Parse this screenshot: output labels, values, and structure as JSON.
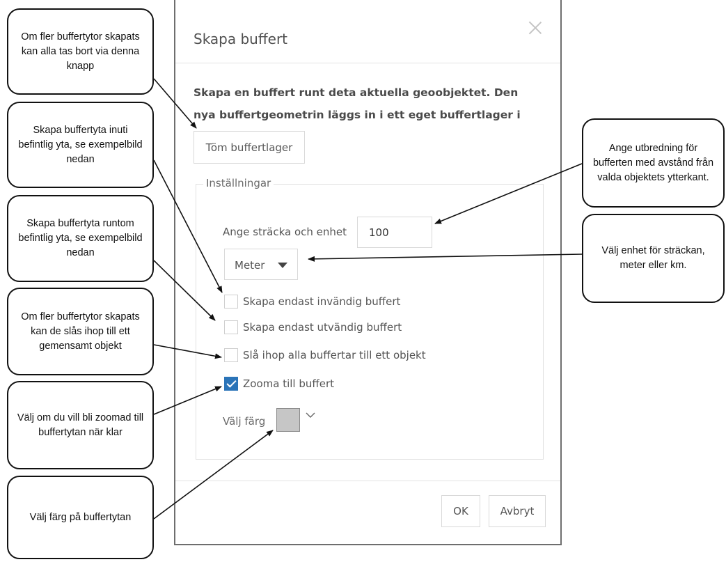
{
  "dialog": {
    "title": "Skapa buffert",
    "description": "Skapa en buffert runt deta aktuella geoobjektet. Den nya buffertgeometrin läggs in i ett eget buffertlager i kartan.",
    "clear_button": "Töm buffertlager",
    "settings_legend": "Inställningar",
    "distance_label": "Ange sträcka och enhet",
    "distance_value": "100",
    "unit_selected": "Meter",
    "checkboxes": [
      {
        "label": "Skapa endast invändig buffert",
        "checked": false
      },
      {
        "label": "Skapa endast utvändig buffert",
        "checked": false
      },
      {
        "label": "Slå ihop alla buffertar till ett objekt",
        "checked": false
      },
      {
        "label": "Zooma till buffert",
        "checked": true
      }
    ],
    "color_label": "Välj färg",
    "color_value": "#c6c6c6",
    "ok_button": "OK",
    "cancel_button": "Avbryt",
    "accent_color": "#2b74b8"
  },
  "callouts": {
    "clear_layer": "Om fler buffertytor skapats kan alla tas bort via denna knapp",
    "inside": "Skapa buffertyta inuti befintlig yta, se exempelbild nedan",
    "outside": "Skapa buffertyta runtom befintlig yta, se exempelbild nedan",
    "merge": "Om fler buffertytor skapats kan de slås ihop till ett gemensamt objekt",
    "zoom": "Välj om du vill bli zoomad till buffertytan när klar",
    "color": "Välj färg på buffertytan",
    "distance": "Ange utbredning för bufferten med avstånd från valda objektets ytterkant.",
    "unit": "Välj enhet för sträckan, meter eller km."
  }
}
